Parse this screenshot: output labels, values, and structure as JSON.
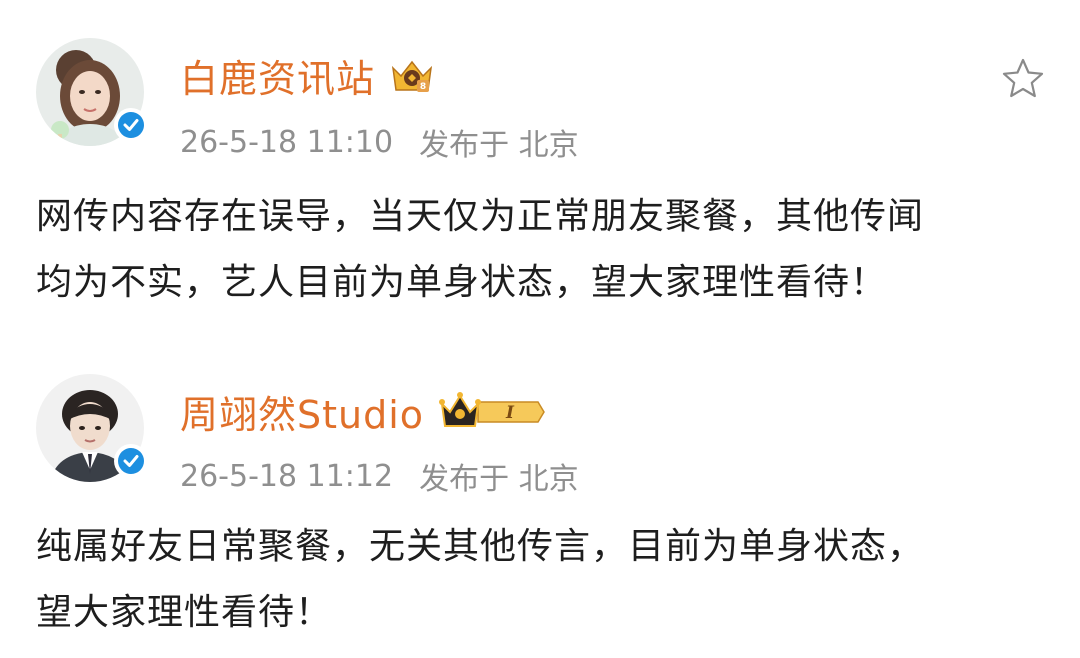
{
  "posts": [
    {
      "username": "白鹿资讯站",
      "timestamp": "26-5-18 11:10",
      "location": "发布于 北京",
      "content_lines": [
        "网传内容存在误导，当天仅为正常朋友聚餐，其他传闻",
        "均为不实，艺人目前为单身状态，望大家理性看待！"
      ],
      "badge_icon": "vip-crown-badge-icon",
      "verified_icon": "verified-check-icon"
    },
    {
      "username": "周翊然Studio",
      "timestamp": "26-5-18 11:12",
      "location": "发布于 北京",
      "content_lines": [
        "纯属好友日常聚餐，无关其他传言，目前为单身状态，",
        "望大家理性看待！"
      ],
      "badge_icon": "crown-level-badge-icon",
      "badge_level": "I",
      "verified_icon": "verified-check-icon"
    }
  ],
  "colors": {
    "username": "#e0702a",
    "meta": "#8f8f8f",
    "verified": "#1d8fe0",
    "badge_gold": "#f2b632"
  }
}
